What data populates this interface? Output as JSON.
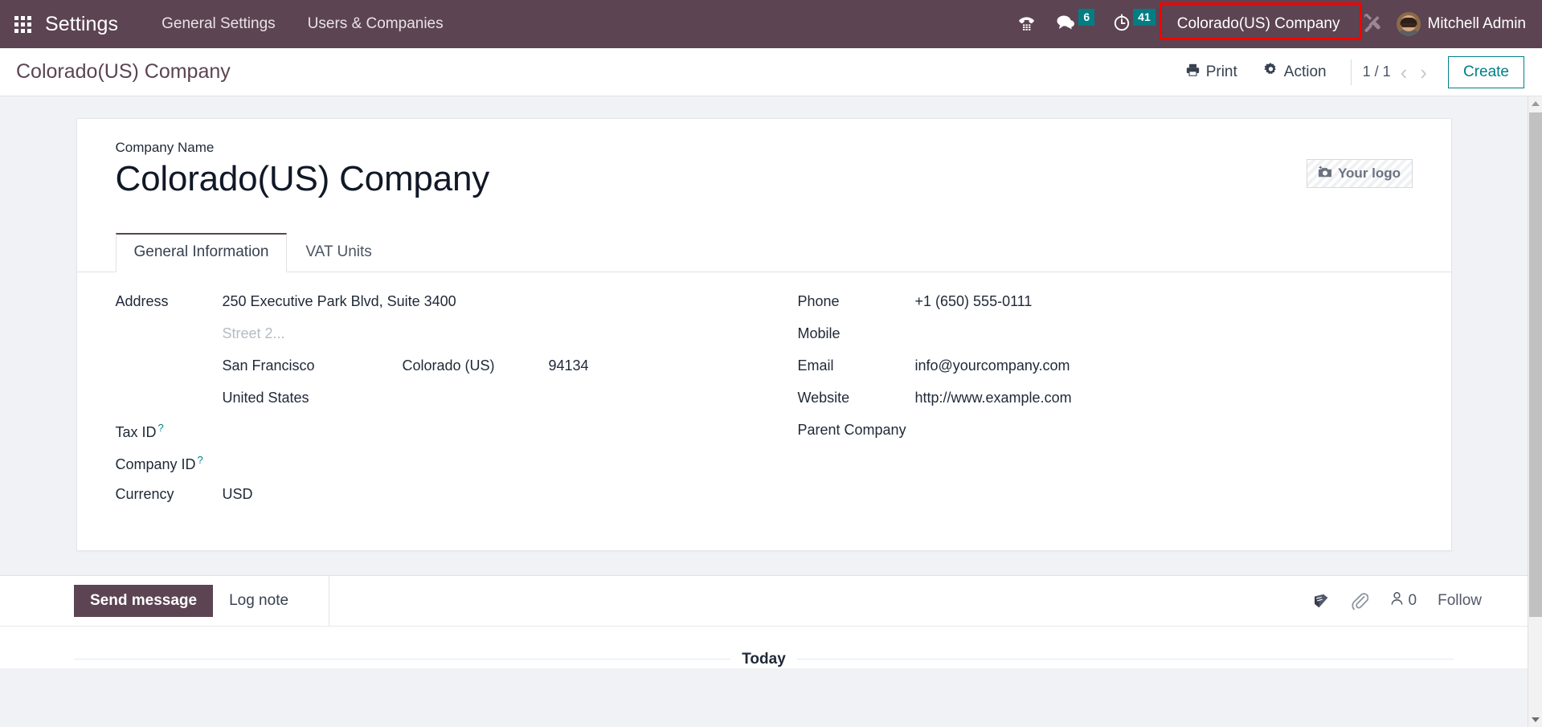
{
  "navbar": {
    "apps_icon": "grid-apps-icon",
    "brand": "Settings",
    "menu_items": [
      {
        "label": "General Settings"
      },
      {
        "label": "Users & Companies"
      }
    ],
    "systray": {
      "voip_icon": "phone-dialpad-icon",
      "messages_icon": "chat-bubble-icon",
      "messages_count": "6",
      "activities_icon": "clock-icon",
      "activities_count": "41",
      "company_switcher": "Colorado(US) Company",
      "debug_icon": "tools-wrench-screwdriver-icon",
      "user_name": "Mitchell Admin",
      "avatar_icon": "user-avatar"
    },
    "highlight_color": "#f50000",
    "background_color": "#5c4452",
    "badge_color": "#017e84"
  },
  "control_panel": {
    "breadcrumb": "Colorado(US) Company",
    "print_label": "Print",
    "print_icon": "printer-icon",
    "action_label": "Action",
    "action_icon": "gear-icon",
    "pager": "1 / 1",
    "prev_icon": "chevron-left-icon",
    "next_icon": "chevron-right-icon",
    "create_label": "Create",
    "accent_color": "#017e84"
  },
  "form": {
    "company_name_label": "Company Name",
    "company_name_value": "Colorado(US) Company",
    "logo_label": "Your logo",
    "logo_icon": "camera-plus-icon",
    "tabs": [
      {
        "label": "General Information",
        "active": true
      },
      {
        "label": "VAT Units",
        "active": false
      }
    ],
    "left_column": {
      "address_label": "Address",
      "street": "250 Executive Park Blvd, Suite 3400",
      "street2_placeholder": "Street 2...",
      "city": "San Francisco",
      "state": "Colorado (US)",
      "zip": "94134",
      "country": "United States",
      "tax_id_label": "Tax ID",
      "tax_id_value": "",
      "company_id_label": "Company ID",
      "company_id_value": "",
      "currency_label": "Currency",
      "currency_value": "USD",
      "help_marker": "?"
    },
    "right_column": {
      "phone_label": "Phone",
      "phone_value": "+1 (650) 555-0111",
      "mobile_label": "Mobile",
      "mobile_value": "",
      "email_label": "Email",
      "email_value": "info@yourcompany.com",
      "website_label": "Website",
      "website_value": "http://www.example.com",
      "parent_company_label": "Parent Company",
      "parent_company_value": ""
    }
  },
  "chatter": {
    "send_message_label": "Send message",
    "log_note_label": "Log note",
    "log_icon": "activity-book-icon",
    "attachment_icon": "paperclip-icon",
    "followers_icon": "user-outline-icon",
    "followers_count": "0",
    "follow_label": "Follow",
    "today_separator": "Today"
  }
}
